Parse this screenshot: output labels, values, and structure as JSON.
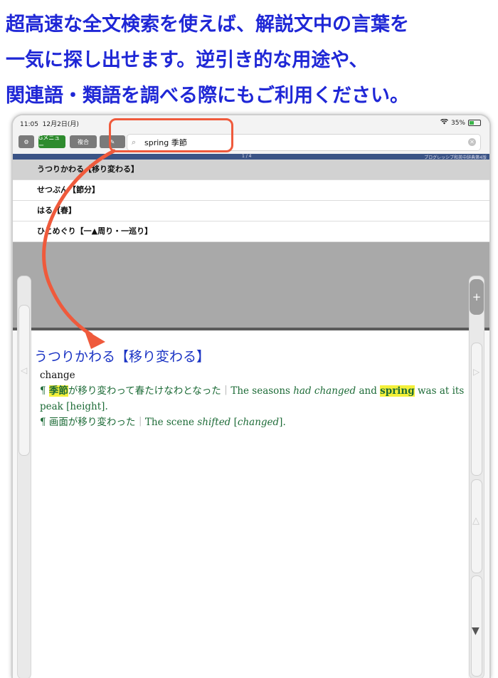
{
  "headline": {
    "line1": "超高速な全文検索を使えば、解説文中の言葉を",
    "line2": "一気に探し出せます。逆引き的な用途や、",
    "line3": "関連語・類語を調べる際にもご利用ください。"
  },
  "status_bar": {
    "time": "11:05",
    "date": "12月2日(月)",
    "battery": "35%"
  },
  "toolbar": {
    "gear_icon": "⚙",
    "menu_label": "Gメニュー",
    "multi_label": "複合",
    "pen_icon": "✎",
    "search_icon": "⌕",
    "clear_icon": "✕"
  },
  "search": {
    "value": "spring 季節"
  },
  "page_info": {
    "count": "1 / 4",
    "dictionary": "プログレッシブ和英中辞典第4版"
  },
  "results": [
    "うつりかわる【移り変わる】",
    "せつぶん【節分】",
    "はる【春】",
    "ひとめぐり【一▲周り・一巡り】"
  ],
  "side": {
    "left_arrow": "◁",
    "plus": "+",
    "right_arrow": "▷",
    "up_arrow": "△",
    "down_arrow": "▼"
  },
  "entry": {
    "headword": "うつりかわる【移り変わる】",
    "gloss": "change",
    "ex1_mark": "¶ ",
    "ex1_hl": "季節",
    "ex1_rest": "が移り変わって春たけなわとなった",
    "sep": "｜",
    "ex1_en_a": "The seasons ",
    "ex1_en_b": "had changed",
    "ex1_en_c": " and ",
    "ex1_en_hl": "spring",
    "ex1_en_d": " was at its peak [height].",
    "ex2_mark": "¶ ",
    "ex2_ja": "画面が移り変わった",
    "ex2_en_a": "The scene ",
    "ex2_en_b": "shifted",
    "ex2_en_c": " [",
    "ex2_en_d": "changed",
    "ex2_en_e": "]."
  },
  "colors": {
    "headline": "#1f27d6",
    "annotation": "#ef5a3c",
    "headword": "#1a33c4",
    "example": "#1d6b37",
    "highlight": "#f4f03a",
    "pagebar": "#3b5486"
  }
}
